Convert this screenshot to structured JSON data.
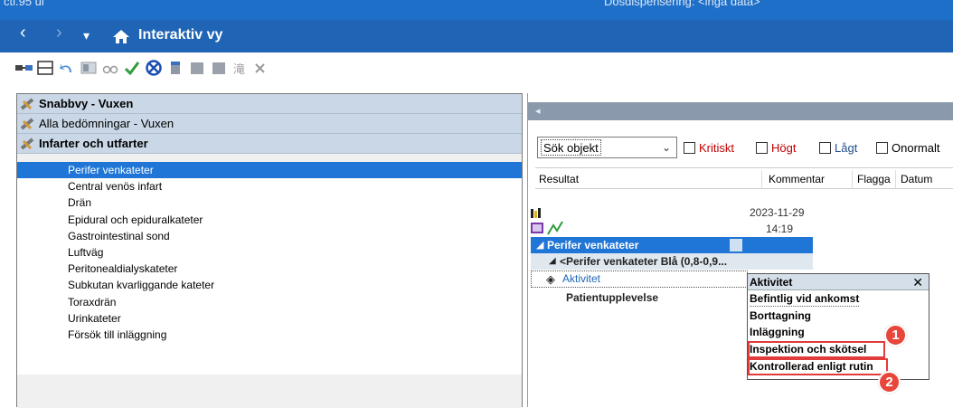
{
  "topbar": {
    "left_fragment": "cti.95 ui",
    "center_fragment": "Dosdispensering: <inga data>"
  },
  "navbar": {
    "title": "Interaktiv vy",
    "back": "‹",
    "forward": "›",
    "dropdown": "▾"
  },
  "categories": [
    {
      "label": "Snabbvy - Vuxen",
      "bold": true
    },
    {
      "label": "Alla bedömningar - Vuxen",
      "bold": false
    },
    {
      "label": "Infarter och utfarter",
      "bold": true
    }
  ],
  "items": [
    "Perifer venkateter",
    "Central venös infart",
    "Drän",
    "Epidural och epiduralkateter",
    "Gastrointestinal sond",
    "Luftväg",
    "Peritonealdialyskateter",
    "Subkutan kvarliggande kateter",
    "Toraxdrän",
    "Urinkateter",
    "Försök till inläggning"
  ],
  "selected_item_index": 0,
  "search": {
    "value": "Sök objekt",
    "chevron": "⌄"
  },
  "filters": [
    "Kritiskt",
    "Högt",
    "Lågt",
    "Onormalt"
  ],
  "columns": [
    "Resultat",
    "Kommentar",
    "Flagga",
    "Datum"
  ],
  "timestamp": {
    "date": "2023-11-29",
    "time": "14:19"
  },
  "tree": {
    "section": "Perifer venkateter",
    "subsection": "<Perifer venkateter Blå (0,8-0,9...",
    "activity": "Aktivitet",
    "patient": "Patientupplevelse"
  },
  "popup": {
    "title": "Aktivitet",
    "close": "✕",
    "options": [
      "Befintlig vid ankomst",
      "Borttagning",
      "Inläggning",
      "Inspektion och skötsel",
      "Kontrollerad enligt rutin"
    ]
  },
  "badges": [
    "1",
    "2"
  ],
  "colors": {
    "nav": "#1f64b5",
    "selection": "#1f76d6",
    "highlight": "#e23b3b",
    "filter_red": "#c00000",
    "filter_blue": "#1f4e8c"
  }
}
